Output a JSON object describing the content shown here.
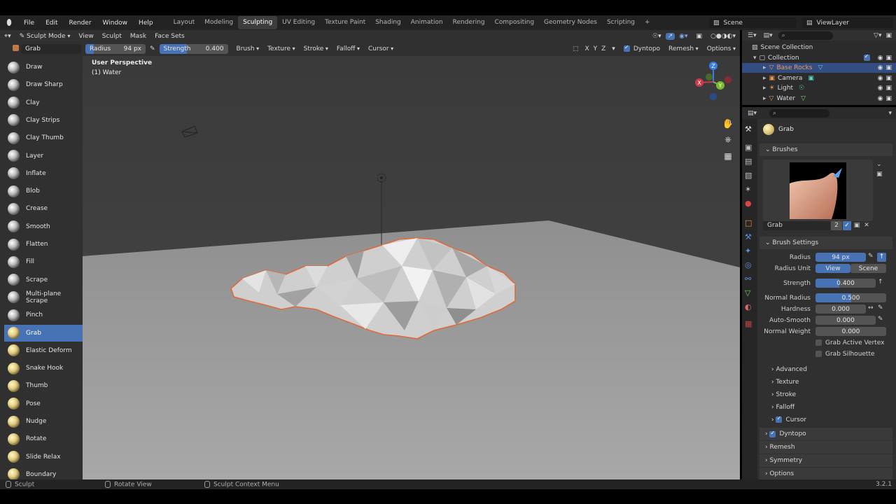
{
  "topbar": {
    "menus": [
      "File",
      "Edit",
      "Render",
      "Window",
      "Help"
    ],
    "workspaces": [
      "Layout",
      "Modeling",
      "Sculpting",
      "UV Editing",
      "Texture Paint",
      "Shading",
      "Animation",
      "Rendering",
      "Compositing",
      "Geometry Nodes",
      "Scripting"
    ],
    "active_workspace": "Sculpting",
    "add_label": "+",
    "scene": "Scene",
    "view_layer": "ViewLayer"
  },
  "header": {
    "mode": "Sculpt Mode",
    "menus": [
      "View",
      "Sculpt",
      "Mask",
      "Face Sets"
    ],
    "brush_name": "Grab",
    "radius_label": "Radius",
    "radius_value": "94 px",
    "strength_label": "Strength",
    "strength_value": "0.400",
    "dropdowns": [
      "Brush",
      "Texture",
      "Stroke",
      "Falloff",
      "Cursor"
    ],
    "axes": [
      "X",
      "Y",
      "Z"
    ],
    "dyntopo": "Dyntopo",
    "remesh": "Remesh",
    "options": "Options"
  },
  "viewport": {
    "perspective": "User Perspective",
    "object": "(1) Water",
    "gizmo_axes": [
      "X",
      "Y",
      "Z"
    ]
  },
  "tools": [
    {
      "label": "Draw",
      "icon": "brush-draw-icon"
    },
    {
      "label": "Draw Sharp",
      "icon": "brush-draw-sharp-icon"
    },
    {
      "label": "Clay",
      "icon": "brush-clay-icon"
    },
    {
      "label": "Clay Strips",
      "icon": "brush-clay-strips-icon"
    },
    {
      "label": "Clay Thumb",
      "icon": "brush-clay-thumb-icon"
    },
    {
      "label": "Layer",
      "icon": "brush-layer-icon"
    },
    {
      "label": "Inflate",
      "icon": "brush-inflate-icon"
    },
    {
      "label": "Blob",
      "icon": "brush-blob-icon"
    },
    {
      "label": "Crease",
      "icon": "brush-crease-icon"
    },
    {
      "label": "Smooth",
      "icon": "brush-smooth-icon"
    },
    {
      "label": "Flatten",
      "icon": "brush-flatten-icon"
    },
    {
      "label": "Fill",
      "icon": "brush-fill-icon"
    },
    {
      "label": "Scrape",
      "icon": "brush-scrape-icon"
    },
    {
      "label": "Multi-plane Scrape",
      "icon": "brush-multiplane-scrape-icon"
    },
    {
      "label": "Pinch",
      "icon": "brush-pinch-icon"
    },
    {
      "label": "Grab",
      "icon": "brush-grab-icon"
    },
    {
      "label": "Elastic Deform",
      "icon": "brush-elastic-deform-icon"
    },
    {
      "label": "Snake Hook",
      "icon": "brush-snake-hook-icon"
    },
    {
      "label": "Thumb",
      "icon": "brush-thumb-icon"
    },
    {
      "label": "Pose",
      "icon": "brush-pose-icon"
    },
    {
      "label": "Nudge",
      "icon": "brush-nudge-icon"
    },
    {
      "label": "Rotate",
      "icon": "brush-rotate-icon"
    },
    {
      "label": "Slide Relax",
      "icon": "brush-slide-relax-icon"
    },
    {
      "label": "Boundary",
      "icon": "brush-boundary-icon"
    }
  ],
  "active_tool": "Grab",
  "outliner": {
    "scene_collection": "Scene Collection",
    "collection": "Collection",
    "items": [
      {
        "label": "Base Rocks",
        "selected": true
      },
      {
        "label": "Camera",
        "selected": false
      },
      {
        "label": "Light",
        "selected": false
      },
      {
        "label": "Water",
        "selected": false
      }
    ]
  },
  "properties": {
    "active_brush": "Grab",
    "brushes_label": "Brushes",
    "brush_field": "Grab",
    "brush_users": "2",
    "brush_settings_label": "Brush Settings",
    "radius_label": "Radius",
    "radius_value": "94 px",
    "radius_unit_label": "Radius Unit",
    "unit_view": "View",
    "unit_scene": "Scene",
    "strength_label": "Strength",
    "strength_value": "0.400",
    "normal_radius_label": "Normal Radius",
    "normal_radius_value": "0.500",
    "hardness_label": "Hardness",
    "hardness_value": "0.000",
    "auto_smooth_label": "Auto-Smooth",
    "auto_smooth_value": "0.000",
    "normal_weight_label": "Normal Weight",
    "normal_weight_value": "0.000",
    "grab_active_vertex": "Grab Active Vertex",
    "grab_silhouette": "Grab Silhouette",
    "subpanels": [
      "Advanced",
      "Texture",
      "Stroke",
      "Falloff"
    ],
    "cursor_label": "Cursor",
    "dyntopo_label": "Dyntopo",
    "remesh_label": "Remesh",
    "symmetry_label": "Symmetry",
    "options_label": "Options",
    "strength_fraction": 0.4,
    "normal_radius_fraction": 0.5
  },
  "statusbar": {
    "left": "Sculpt",
    "middle": "Rotate View",
    "context": "Sculpt Context Menu",
    "version": "3.2.1"
  }
}
